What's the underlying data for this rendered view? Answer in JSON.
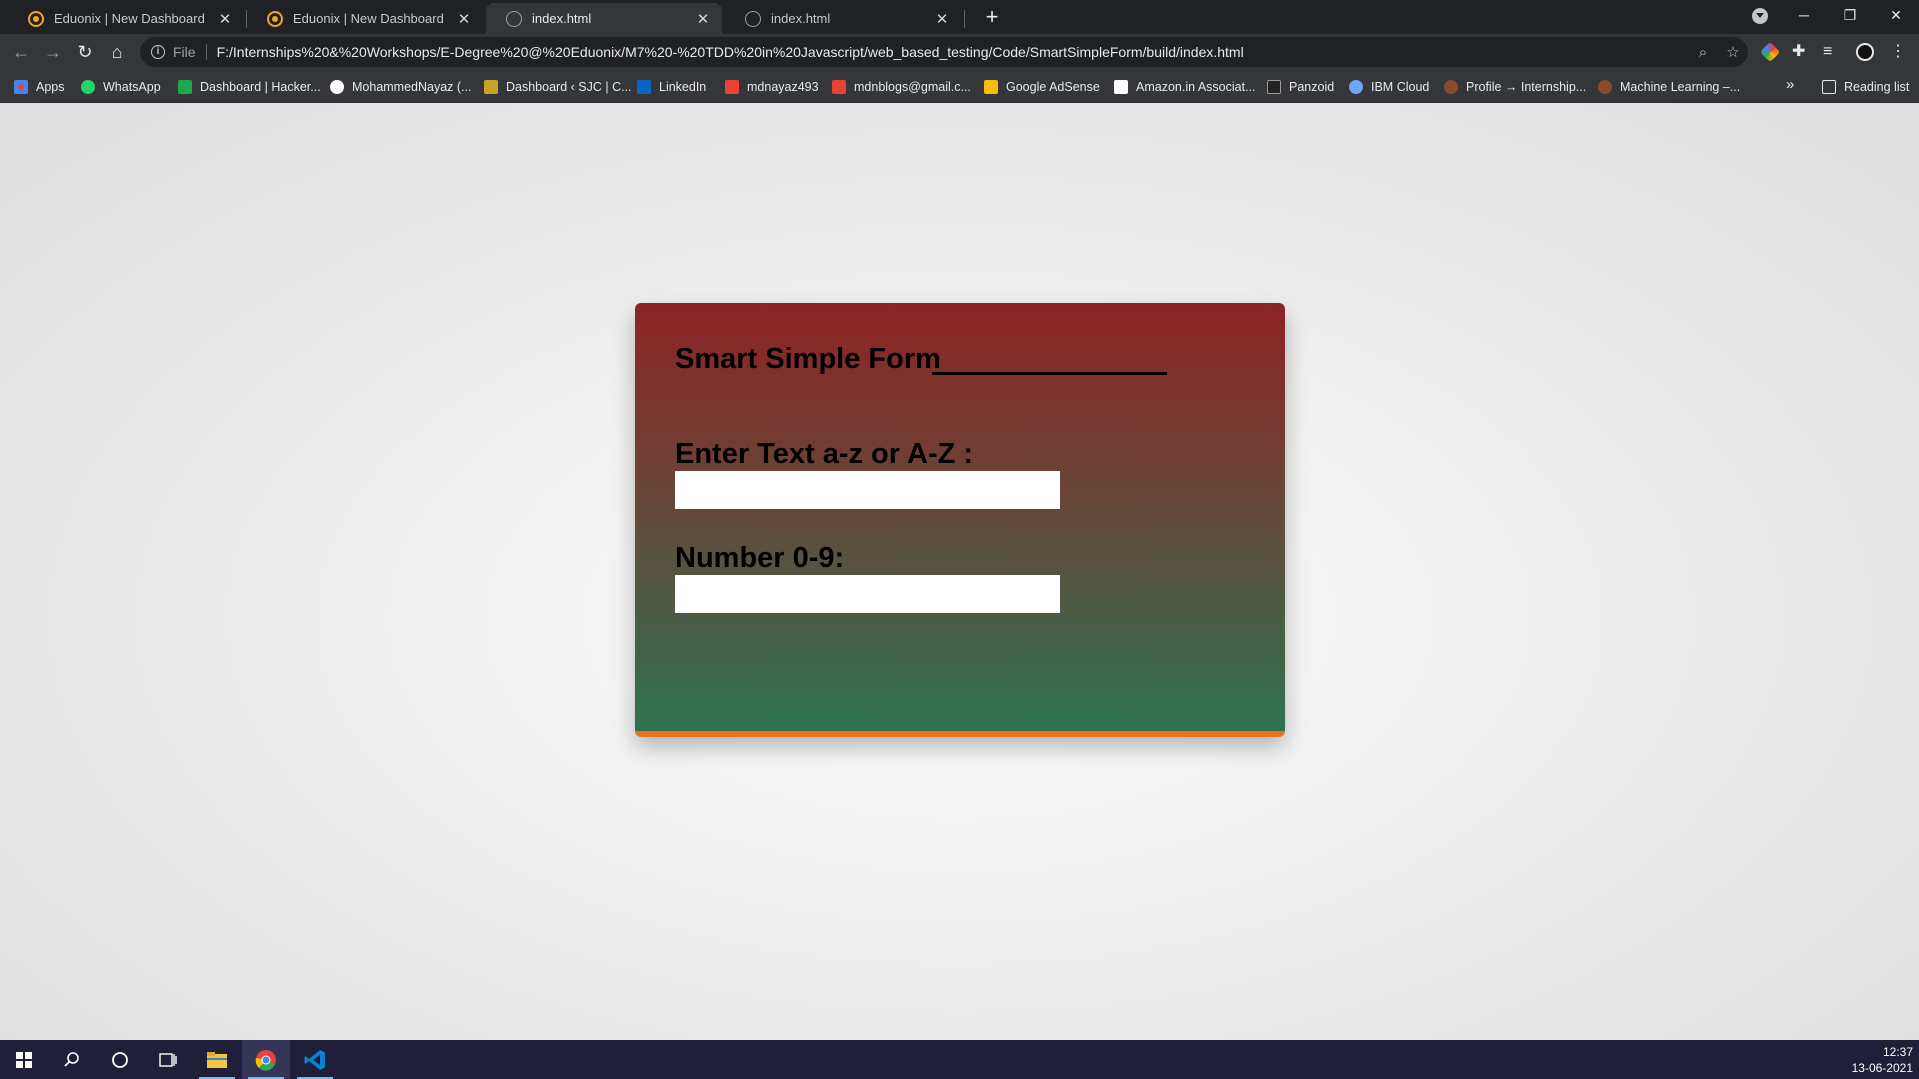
{
  "browser": {
    "tabs": [
      {
        "title": "Eduonix | New Dashboard",
        "icon": "eduonix-icon",
        "active": false
      },
      {
        "title": "Eduonix | New Dashboard",
        "icon": "eduonix-icon",
        "active": false
      },
      {
        "title": "index.html",
        "icon": "globe-icon",
        "active": true
      },
      {
        "title": "index.html",
        "icon": "globe-icon",
        "active": false
      }
    ],
    "tab_close_glyph": "✕",
    "new_tab_glyph": "+",
    "omnibox": {
      "scheme_label": "File",
      "url": "F:/Internships%20&%20Workshops/E-Degree%20@%20Eduonix/M7%20-%20TDD%20in%20Javascript/web_based_testing/Code/SmartSimpleForm/build/index.html"
    },
    "bookmarks": [
      {
        "label": "Apps",
        "icon": "apps-grid-icon",
        "color": "#ea4335"
      },
      {
        "label": "WhatsApp",
        "icon": "whatsapp-icon",
        "color": "#25d366"
      },
      {
        "label": "Dashboard | Hacker...",
        "icon": "hackerrank-icon",
        "color": "#1ba94c"
      },
      {
        "label": "MohammedNayaz (...",
        "icon": "github-icon",
        "color": "#ffffff"
      },
      {
        "label": "Dashboard ‹ SJC | C...",
        "icon": "sjc-icon",
        "color": "#c9a227"
      },
      {
        "label": "LinkedIn",
        "icon": "linkedin-icon",
        "color": "#0a66c2"
      },
      {
        "label": "mdnayaz493",
        "icon": "gmail-icon",
        "color": "#ea4335"
      },
      {
        "label": "mdnblogs@gmail.c...",
        "icon": "gmail-icon",
        "color": "#ea4335"
      },
      {
        "label": "Google AdSense",
        "icon": "adsense-icon",
        "color": "#fbbc04"
      },
      {
        "label": "Amazon.in Associat...",
        "icon": "amazon-icon",
        "color": "#ffffff"
      },
      {
        "label": "Panzoid",
        "icon": "panzoid-icon",
        "color": "#222222"
      },
      {
        "label": "IBM Cloud",
        "icon": "ibm-cloud-icon",
        "color": "#6ea6ff"
      },
      {
        "label": "Profile → Internship...",
        "icon": "internshala-icon",
        "color": "#8a4b2a"
      },
      {
        "label": "Machine Learning –...",
        "icon": "internshala-icon",
        "color": "#8a4b2a"
      }
    ],
    "bookmarks_more_glyph": "»",
    "reading_list_label": "Reading list"
  },
  "form": {
    "title": "Smart Simple Form",
    "text_label": "Enter Text a-z or A-Z :",
    "text_value": "",
    "number_label": "Number 0-9:",
    "number_value": ""
  },
  "colors": {
    "card_top": "#8e2326",
    "card_bottom": "#2f7350",
    "card_accent_border": "#e8711d"
  },
  "taskbar": {
    "time": "12:37",
    "date": "13-06-2021"
  }
}
